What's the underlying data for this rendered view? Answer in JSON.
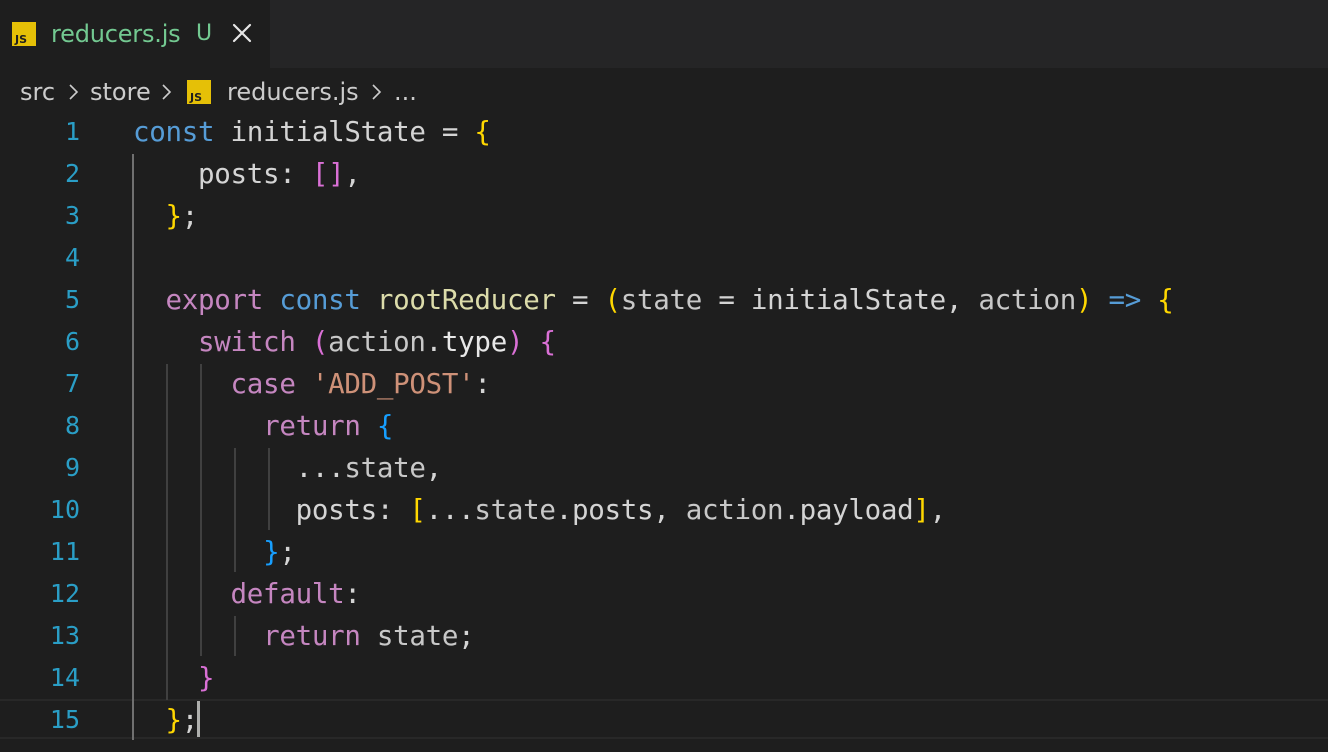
{
  "tab": {
    "icon": "js-file-icon",
    "icon_label": "JS",
    "title": "reducers.js",
    "status": "U",
    "close_icon": "close-icon"
  },
  "breadcrumb": {
    "items": [
      "src",
      "store",
      "reducers.js",
      "..."
    ],
    "file_icon_label": "JS"
  },
  "colors": {
    "keyword": "#569cd6",
    "control": "#c586c0",
    "function": "#dcdcaa",
    "string": "#ce9178",
    "line_number": "#2a9ec6",
    "untracked": "#73c991",
    "bracket_1": "#ffd700",
    "bracket_2": "#da70d6",
    "bracket_3": "#179fff",
    "background": "#1e1e1e"
  },
  "editor": {
    "line_numbers": [
      "1",
      "2",
      "3",
      "4",
      "5",
      "6",
      "7",
      "8",
      "9",
      "10",
      "11",
      "12",
      "13",
      "14",
      "15"
    ],
    "lines": [
      [
        [
          "kw",
          "const"
        ],
        [
          "plain",
          " initialState = "
        ],
        [
          "br1",
          "{"
        ]
      ],
      [
        [
          "plain",
          "    posts: "
        ],
        [
          "br2",
          "[]"
        ],
        [
          "plain",
          ","
        ]
      ],
      [
        [
          "plain",
          "  "
        ],
        [
          "br1",
          "}"
        ],
        [
          "plain",
          ";"
        ]
      ],
      [],
      [
        [
          "plain",
          "  "
        ],
        [
          "ctl",
          "export"
        ],
        [
          "plain",
          " "
        ],
        [
          "kw",
          "const"
        ],
        [
          "plain",
          " "
        ],
        [
          "fn",
          "rootReducer"
        ],
        [
          "plain",
          " = "
        ],
        [
          "br1",
          "("
        ],
        [
          "dim",
          "state"
        ],
        [
          "plain",
          " = initialState, "
        ],
        [
          "dim",
          "action"
        ],
        [
          "br1",
          ")"
        ],
        [
          "plain",
          " "
        ],
        [
          "kw",
          "=>"
        ],
        [
          "plain",
          " "
        ],
        [
          "br1",
          "{"
        ]
      ],
      [
        [
          "plain",
          "    "
        ],
        [
          "ctl",
          "switch"
        ],
        [
          "plain",
          " "
        ],
        [
          "br2",
          "("
        ],
        [
          "dim",
          "action"
        ],
        [
          "plain",
          "."
        ],
        [
          "prop",
          "type"
        ],
        [
          "br2",
          ")"
        ],
        [
          "plain",
          " "
        ],
        [
          "br2",
          "{"
        ]
      ],
      [
        [
          "plain",
          "      "
        ],
        [
          "ctl",
          "case"
        ],
        [
          "plain",
          " "
        ],
        [
          "str",
          "'ADD_POST'"
        ],
        [
          "plain",
          ":"
        ]
      ],
      [
        [
          "plain",
          "        "
        ],
        [
          "ctl",
          "return"
        ],
        [
          "plain",
          " "
        ],
        [
          "br3",
          "{"
        ]
      ],
      [
        [
          "plain",
          "          ..."
        ],
        [
          "dim",
          "state"
        ],
        [
          "plain",
          ","
        ]
      ],
      [
        [
          "plain",
          "          posts: "
        ],
        [
          "br1",
          "["
        ],
        [
          "plain",
          "..."
        ],
        [
          "dim",
          "state"
        ],
        [
          "plain",
          ".posts, "
        ],
        [
          "dim",
          "action"
        ],
        [
          "plain",
          ".payload"
        ],
        [
          "br1",
          "]"
        ],
        [
          "plain",
          ","
        ]
      ],
      [
        [
          "plain",
          "        "
        ],
        [
          "br3",
          "}"
        ],
        [
          "plain",
          ";"
        ]
      ],
      [
        [
          "plain",
          "      "
        ],
        [
          "ctl",
          "default"
        ],
        [
          "plain",
          ":"
        ]
      ],
      [
        [
          "plain",
          "        "
        ],
        [
          "ctl",
          "return"
        ],
        [
          "plain",
          " "
        ],
        [
          "dim",
          "state"
        ],
        [
          "plain",
          ";"
        ]
      ],
      [
        [
          "plain",
          "    "
        ],
        [
          "br2",
          "}"
        ]
      ],
      [
        [
          "plain",
          "  "
        ],
        [
          "br1",
          "}"
        ],
        [
          "plain",
          ";"
        ]
      ]
    ]
  }
}
